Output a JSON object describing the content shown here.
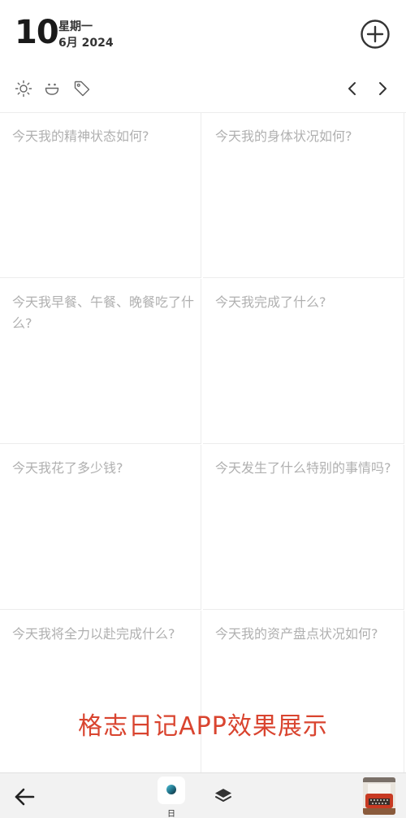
{
  "header": {
    "day": "10",
    "weekday": "星期一",
    "month_year": "6月 2024"
  },
  "toolbar": {
    "icons": [
      "sun-icon",
      "smiley-icon",
      "tag-icon",
      "chevron-left-icon",
      "chevron-right-icon"
    ]
  },
  "prompts": [
    "今天我的精神状态如何?",
    "今天我的身体状况如何?",
    "今天我早餐、午餐、晚餐吃了什么?",
    "今天我完成了什么?",
    "今天我花了多少钱?",
    "今天发生了什么特别的事情吗?",
    "今天我将全力以赴完成什么?",
    "今天我的资产盘点状况如何?"
  ],
  "watermark": "格志日记APP效果展示",
  "bottom_nav": {
    "day_tab_label": "日"
  },
  "colors": {
    "prompt_text": "#b0b0b0",
    "watermark": "#d9442f",
    "grid_line": "#ececec",
    "bottom_bar": "#f2f2f2"
  }
}
